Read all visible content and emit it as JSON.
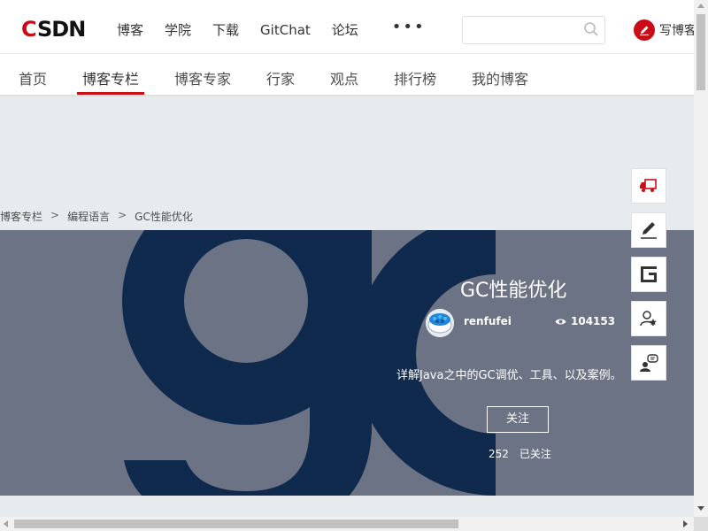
{
  "header": {
    "logo": "CSDN",
    "nav": [
      "博客",
      "学院",
      "下载",
      "GitChat",
      "论坛"
    ],
    "more": "•••",
    "search_placeholder": "",
    "write_label": "写博客"
  },
  "subnav": {
    "items": [
      "首页",
      "博客专栏",
      "博客专家",
      "行家",
      "观点",
      "排行榜",
      "我的博客"
    ],
    "active": "博客专栏"
  },
  "breadcrumb": [
    "博客专栏",
    "编程语言",
    "GC性能优化"
  ],
  "breadcrumb_sep": ">",
  "column": {
    "title": "GC性能优化",
    "author": "renfufei",
    "views": "104153",
    "description": "详解Java之中的GC调优、工具、以及案例。",
    "follow_label": "关注",
    "follower_count": "252",
    "follower_label": "已关注"
  },
  "colors": {
    "brand_red": "#ca0c16",
    "hero_bg": "#6b7384",
    "hero_glyph": "#0f2a4d"
  },
  "tools": [
    "truck-icon",
    "edit-icon",
    "guide-icon",
    "expert-icon",
    "feedback-icon"
  ]
}
